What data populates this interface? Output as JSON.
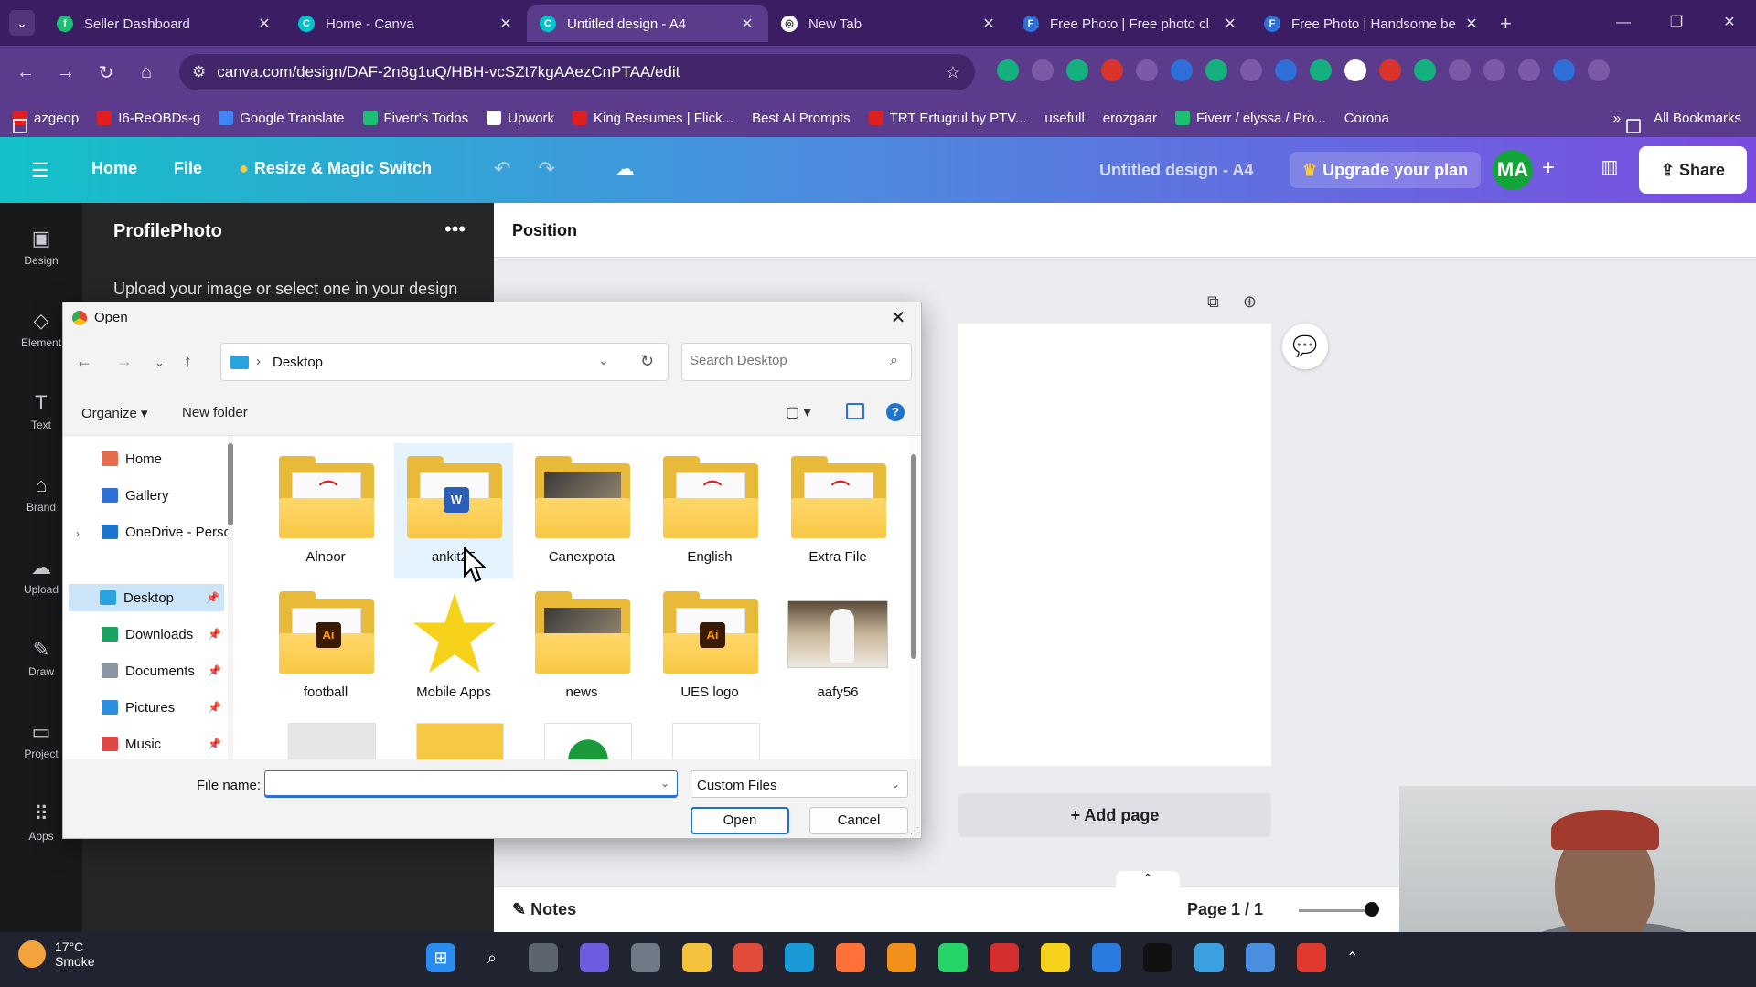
{
  "browser": {
    "tabs": [
      {
        "title": "Seller Dashboard",
        "color": "#1dbf73",
        "glyph": "f"
      },
      {
        "title": "Home - Canva",
        "color": "#00c4cc",
        "glyph": "C"
      },
      {
        "title": "Untitled design - A4",
        "color": "#00c4cc",
        "glyph": "C",
        "active": true
      },
      {
        "title": "New Tab",
        "color": "#ffffff",
        "glyph": "◎"
      },
      {
        "title": "Free Photo | Free photo cl",
        "color": "#2e6fd8",
        "glyph": "F"
      },
      {
        "title": "Free Photo | Handsome be",
        "color": "#2e6fd8",
        "glyph": "F"
      }
    ],
    "url": "canva.com/design/DAF-2n8g1uQ/HBH-vcSZt7kgAAezCnPTAA/edit",
    "bookmarks": [
      {
        "label": "azgeop",
        "icon": "red"
      },
      {
        "label": "I6-ReOBDs-g",
        "icon": "red"
      },
      {
        "label": "Google Translate",
        "icon": "blue"
      },
      {
        "label": "Fiverr's Todos",
        "icon": "green"
      },
      {
        "label": "Upwork",
        "icon": ""
      },
      {
        "label": "King Resumes | Flick...",
        "icon": "red"
      },
      {
        "label": "Best AI Prompts",
        "icon": "folder"
      },
      {
        "label": "TRT Ertugrul by PTV...",
        "icon": "red"
      },
      {
        "label": "usefull",
        "icon": "folder"
      },
      {
        "label": "erozgaar",
        "icon": "folder"
      },
      {
        "label": "Fiverr / elyssa / Pro...",
        "icon": "green"
      },
      {
        "label": "Corona",
        "icon": "folder"
      }
    ],
    "more_bookmarks": "»",
    "all_bookmarks": "All Bookmarks"
  },
  "canva": {
    "nav": {
      "home": "Home",
      "file": "File",
      "resize": "Resize & Magic Switch"
    },
    "doc_title": "Untitled design - A4",
    "upgrade": "Upgrade your plan",
    "avatar": "MA",
    "share": "Share",
    "rail": [
      {
        "label": "Design",
        "icon": "▣"
      },
      {
        "label": "Element",
        "icon": "◇"
      },
      {
        "label": "Text",
        "icon": "T"
      },
      {
        "label": "Brand",
        "icon": "⌂"
      },
      {
        "label": "Upload",
        "icon": "☁"
      },
      {
        "label": "Draw",
        "icon": "✎"
      },
      {
        "label": "Project",
        "icon": "▭"
      },
      {
        "label": "Apps",
        "icon": "⠿"
      }
    ],
    "panel": {
      "title": "ProfilePhoto",
      "more": "•••",
      "desc": "Upload your image or select one in your design"
    },
    "position_label": "Position",
    "add_page": "+ Add page",
    "notes": "Notes",
    "page_info": "Page 1 / 1"
  },
  "dialog": {
    "title": "Open",
    "location": "Desktop",
    "search_placeholder": "Search Desktop",
    "organize": "Organize ▾",
    "new_folder": "New folder",
    "nav_items": [
      {
        "label": "Home",
        "color": "#e56b4a"
      },
      {
        "label": "Gallery",
        "color": "#2e6fd8"
      },
      {
        "label": "OneDrive - Perso",
        "color": "#1e75d0"
      },
      {
        "label": "Desktop",
        "color": "#29a3e0",
        "pinned": true,
        "selected": true
      },
      {
        "label": "Downloads",
        "color": "#1aa260",
        "pinned": true
      },
      {
        "label": "Documents",
        "color": "#8a95a5",
        "pinned": true
      },
      {
        "label": "Pictures",
        "color": "#2e8fe0",
        "pinned": true
      },
      {
        "label": "Music",
        "color": "#e04848",
        "pinned": true
      }
    ],
    "files": [
      {
        "name": "Alnoor",
        "kind": "folder",
        "badge": "pdf"
      },
      {
        "name": "ankit25",
        "kind": "folder",
        "badge": "word",
        "selected": true
      },
      {
        "name": "Canexpota",
        "kind": "folder",
        "badge": "photo"
      },
      {
        "name": "English",
        "kind": "folder",
        "badge": "pdf"
      },
      {
        "name": "Extra File",
        "kind": "folder",
        "badge": "pdf"
      },
      {
        "name": "football",
        "kind": "folder",
        "badge": "ai"
      },
      {
        "name": "Mobile Apps",
        "kind": "star"
      },
      {
        "name": "news",
        "kind": "folder",
        "badge": "photo"
      },
      {
        "name": "UES logo",
        "kind": "folder",
        "badge": "ai"
      },
      {
        "name": "aafy56",
        "kind": "image"
      }
    ],
    "file_name_label": "File name:",
    "file_name_value": "",
    "file_type": "Custom Files",
    "open_button": "Open",
    "cancel_button": "Cancel"
  },
  "taskbar": {
    "temperature": "17°C",
    "condition": "Smoke"
  }
}
